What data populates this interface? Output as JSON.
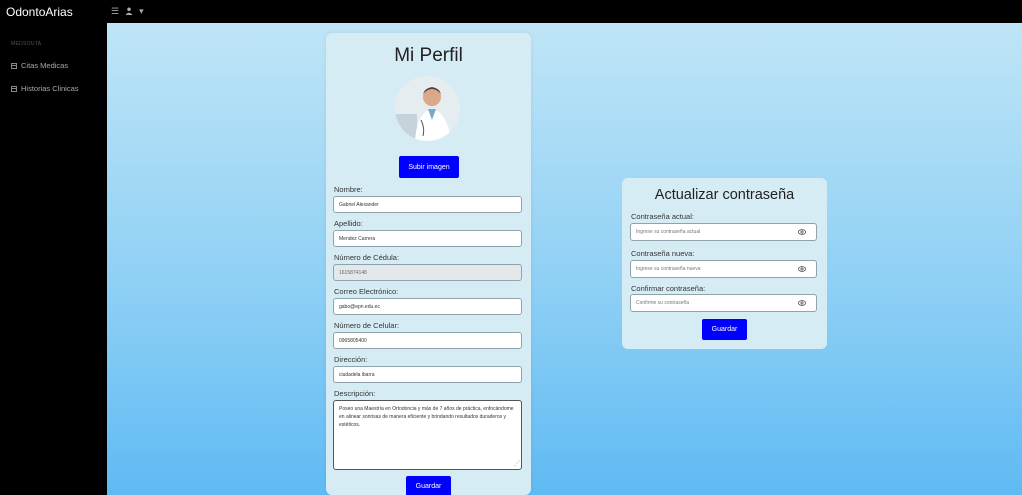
{
  "app": {
    "brand": "OdontoArias"
  },
  "topbar": {
    "menu_icon": "hamburger-icon",
    "user_icon": "user-icon",
    "caret": "▾"
  },
  "sidebar": {
    "heading": "MEDSOUTA",
    "items": [
      {
        "label": "Citas Medicas",
        "icon": "calendar-icon"
      },
      {
        "label": "Historias Clinicas",
        "icon": "document-icon"
      }
    ]
  },
  "profile": {
    "title": "Mi Perfil",
    "upload_label": "Subir imagen",
    "fields": {
      "nombre": {
        "label": "Nombre:",
        "value": "Gabriel Alexander"
      },
      "apellido": {
        "label": "Apellido:",
        "value": "Mendez Carrera"
      },
      "cedula": {
        "label": "Número de Cédula:",
        "value": "1615874148"
      },
      "correo": {
        "label": "Correo Electrónico:",
        "value": "gabo@epn.edu.ec"
      },
      "celular": {
        "label": "Número de Celular:",
        "value": "0965805400"
      },
      "direccion": {
        "label": "Dirección:",
        "value": "ciudadela ibarra"
      },
      "descripcion": {
        "label": "Descripción:",
        "value": "Poseo una Maestría en Ortodoncia y más de 7 años de práctica, enfocándome en alinear sonrisas de manera eficiente y brindando resultados duraderos y estéticos."
      }
    },
    "save_label": "Guardar"
  },
  "password": {
    "title": "Actualizar contraseña",
    "current": {
      "label": "Contraseña actual:",
      "placeholder": "Ingrese su contraseña actual"
    },
    "new": {
      "label": "Contraseña nueva:",
      "placeholder": "Ingrese su contraseña nueva"
    },
    "confirm": {
      "label": "Confirmar contraseña:",
      "placeholder": "Confirme su contraseña"
    },
    "save_label": "Guardar",
    "eye_icon": "eye-icon"
  },
  "colors": {
    "primary_button": "#0000ff",
    "card_bg": "#d6ecf5",
    "topbar": "#000000"
  }
}
